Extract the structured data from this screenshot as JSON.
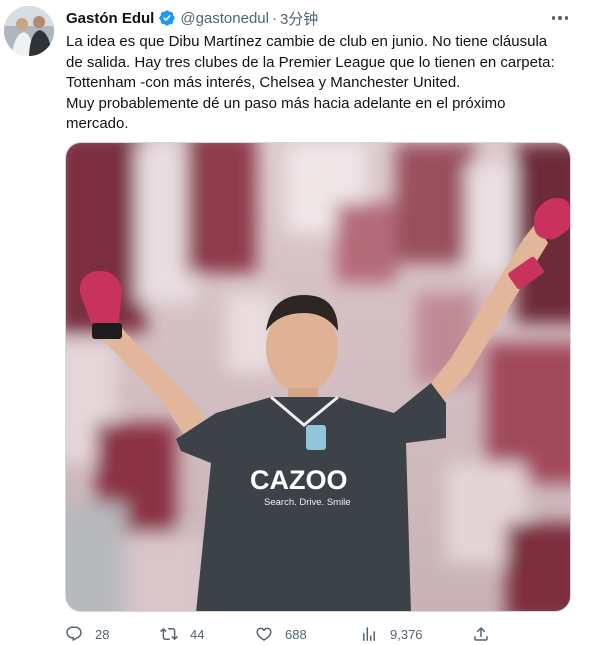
{
  "tweet": {
    "display_name": "Gastón Edul",
    "handle": "@gastonedul",
    "separator": "·",
    "time": "3分钟",
    "text_lines": [
      "La idea es que Dibu Martínez cambie de club en junio. No tiene cláusula",
      "de salida. Hay tres clubes de la Premier League que lo tienen en carpeta:",
      "Tottenham -con más interés, Chelsea y Manchester United.",
      "Muy probablemente dé un paso más hacia adelante en el próximo",
      "mercado."
    ],
    "photo": {
      "shirt_sponsor": "CAZOO",
      "shirt_slogan": "Search. Drive. Smile"
    }
  },
  "actions": {
    "replies": "28",
    "retweets": "44",
    "likes": "688",
    "views": "9,376"
  },
  "colors": {
    "verified": "#1d9bf0",
    "secondary_text": "#536471",
    "jersey": "#3d4248",
    "glove": "#c8325c"
  },
  "icons": [
    "verified-badge-icon",
    "more-icon",
    "reply-icon",
    "retweet-icon",
    "like-icon",
    "views-icon",
    "share-icon"
  ]
}
